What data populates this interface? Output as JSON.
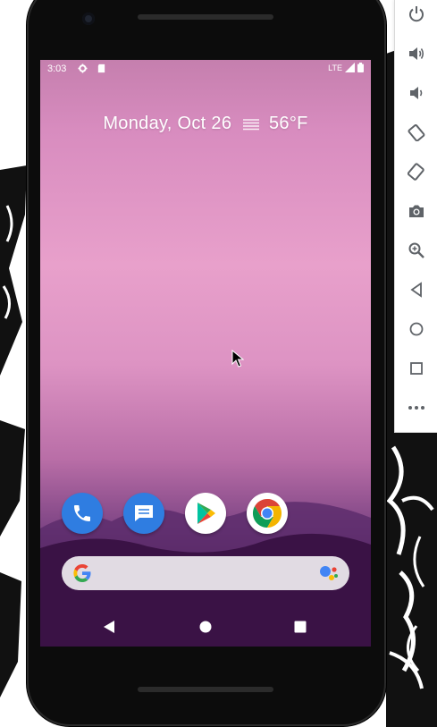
{
  "status_bar": {
    "time": "3:03",
    "network": "LTE",
    "icons": [
      "settings-gear-icon",
      "sd-card-icon",
      "signal-icon",
      "battery-icon"
    ]
  },
  "date_widget": {
    "date": "Monday, Oct 26",
    "weather_icon": "fog-icon",
    "temperature": "56°F"
  },
  "dock": {
    "apps": [
      {
        "name": "Phone",
        "icon": "phone-icon"
      },
      {
        "name": "Messages",
        "icon": "messages-icon"
      },
      {
        "name": "Play Store",
        "icon": "play-store-icon"
      },
      {
        "name": "Chrome",
        "icon": "chrome-icon"
      }
    ]
  },
  "search_bar": {
    "logo": "google-g-icon",
    "assistant": "assistant-mic-icon"
  },
  "nav_bar": {
    "buttons": [
      "back-icon",
      "home-icon",
      "recents-icon"
    ]
  },
  "emulator_toolbar": {
    "buttons": [
      "power-icon",
      "volume-up-icon",
      "volume-down-icon",
      "rotate-left-icon",
      "rotate-right-icon",
      "camera-icon",
      "zoom-icon",
      "back-icon",
      "home-icon",
      "overview-icon",
      "more-icon"
    ]
  },
  "colors": {
    "wallpaper_top": "#c57fae",
    "wallpaper_mid": "#e8a0cb",
    "wallpaper_bottom": "#2b0d36",
    "phone_frame": "#0c0c0c",
    "app_blue": "#2f7de1",
    "toolbar_icon": "#5f6368"
  }
}
